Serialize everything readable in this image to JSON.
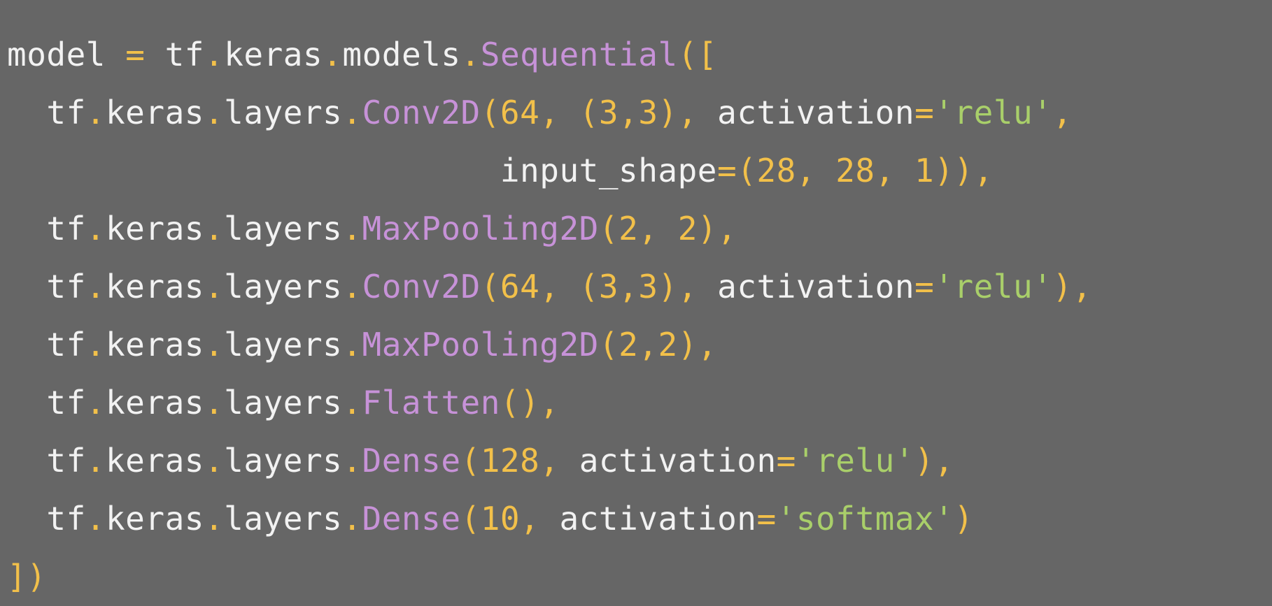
{
  "colors": {
    "background": "#666666",
    "identifier": "#f2f2f2",
    "punctuation": "#f2c04a",
    "function": "#c792d8",
    "number": "#f2c04a",
    "string": "#a9cf6a"
  },
  "code": {
    "lines": [
      [
        {
          "t": "model",
          "k": "id"
        },
        {
          "t": " ",
          "k": "id"
        },
        {
          "t": "=",
          "k": "punct"
        },
        {
          "t": " tf",
          "k": "id"
        },
        {
          "t": ".",
          "k": "punct"
        },
        {
          "t": "keras",
          "k": "id"
        },
        {
          "t": ".",
          "k": "punct"
        },
        {
          "t": "models",
          "k": "id"
        },
        {
          "t": ".",
          "k": "punct"
        },
        {
          "t": "Sequential",
          "k": "func"
        },
        {
          "t": "([",
          "k": "punct"
        }
      ],
      [
        {
          "t": "  tf",
          "k": "id"
        },
        {
          "t": ".",
          "k": "punct"
        },
        {
          "t": "keras",
          "k": "id"
        },
        {
          "t": ".",
          "k": "punct"
        },
        {
          "t": "layers",
          "k": "id"
        },
        {
          "t": ".",
          "k": "punct"
        },
        {
          "t": "Conv2D",
          "k": "func"
        },
        {
          "t": "(",
          "k": "punct"
        },
        {
          "t": "64",
          "k": "num"
        },
        {
          "t": ",",
          "k": "punct"
        },
        {
          "t": " ",
          "k": "id"
        },
        {
          "t": "(",
          "k": "punct"
        },
        {
          "t": "3",
          "k": "num"
        },
        {
          "t": ",",
          "k": "punct"
        },
        {
          "t": "3",
          "k": "num"
        },
        {
          "t": ")",
          "k": "punct"
        },
        {
          "t": ",",
          "k": "punct"
        },
        {
          "t": " activation",
          "k": "id"
        },
        {
          "t": "=",
          "k": "punct"
        },
        {
          "t": "'relu'",
          "k": "str"
        },
        {
          "t": ",",
          "k": "punct"
        }
      ],
      [
        {
          "t": "                         input_shape",
          "k": "id"
        },
        {
          "t": "=(",
          "k": "punct"
        },
        {
          "t": "28",
          "k": "num"
        },
        {
          "t": ",",
          "k": "punct"
        },
        {
          "t": " ",
          "k": "id"
        },
        {
          "t": "28",
          "k": "num"
        },
        {
          "t": ",",
          "k": "punct"
        },
        {
          "t": " ",
          "k": "id"
        },
        {
          "t": "1",
          "k": "num"
        },
        {
          "t": ")),",
          "k": "punct"
        }
      ],
      [
        {
          "t": "  tf",
          "k": "id"
        },
        {
          "t": ".",
          "k": "punct"
        },
        {
          "t": "keras",
          "k": "id"
        },
        {
          "t": ".",
          "k": "punct"
        },
        {
          "t": "layers",
          "k": "id"
        },
        {
          "t": ".",
          "k": "punct"
        },
        {
          "t": "MaxPooling2D",
          "k": "func"
        },
        {
          "t": "(",
          "k": "punct"
        },
        {
          "t": "2",
          "k": "num"
        },
        {
          "t": ",",
          "k": "punct"
        },
        {
          "t": " ",
          "k": "id"
        },
        {
          "t": "2",
          "k": "num"
        },
        {
          "t": "),",
          "k": "punct"
        }
      ],
      [
        {
          "t": "  tf",
          "k": "id"
        },
        {
          "t": ".",
          "k": "punct"
        },
        {
          "t": "keras",
          "k": "id"
        },
        {
          "t": ".",
          "k": "punct"
        },
        {
          "t": "layers",
          "k": "id"
        },
        {
          "t": ".",
          "k": "punct"
        },
        {
          "t": "Conv2D",
          "k": "func"
        },
        {
          "t": "(",
          "k": "punct"
        },
        {
          "t": "64",
          "k": "num"
        },
        {
          "t": ",",
          "k": "punct"
        },
        {
          "t": " ",
          "k": "id"
        },
        {
          "t": "(",
          "k": "punct"
        },
        {
          "t": "3",
          "k": "num"
        },
        {
          "t": ",",
          "k": "punct"
        },
        {
          "t": "3",
          "k": "num"
        },
        {
          "t": ")",
          "k": "punct"
        },
        {
          "t": ",",
          "k": "punct"
        },
        {
          "t": " activation",
          "k": "id"
        },
        {
          "t": "=",
          "k": "punct"
        },
        {
          "t": "'relu'",
          "k": "str"
        },
        {
          "t": "),",
          "k": "punct"
        }
      ],
      [
        {
          "t": "  tf",
          "k": "id"
        },
        {
          "t": ".",
          "k": "punct"
        },
        {
          "t": "keras",
          "k": "id"
        },
        {
          "t": ".",
          "k": "punct"
        },
        {
          "t": "layers",
          "k": "id"
        },
        {
          "t": ".",
          "k": "punct"
        },
        {
          "t": "MaxPooling2D",
          "k": "func"
        },
        {
          "t": "(",
          "k": "punct"
        },
        {
          "t": "2",
          "k": "num"
        },
        {
          "t": ",",
          "k": "punct"
        },
        {
          "t": "2",
          "k": "num"
        },
        {
          "t": "),",
          "k": "punct"
        }
      ],
      [
        {
          "t": "  tf",
          "k": "id"
        },
        {
          "t": ".",
          "k": "punct"
        },
        {
          "t": "keras",
          "k": "id"
        },
        {
          "t": ".",
          "k": "punct"
        },
        {
          "t": "layers",
          "k": "id"
        },
        {
          "t": ".",
          "k": "punct"
        },
        {
          "t": "Flatten",
          "k": "func"
        },
        {
          "t": "(),",
          "k": "punct"
        }
      ],
      [
        {
          "t": "  tf",
          "k": "id"
        },
        {
          "t": ".",
          "k": "punct"
        },
        {
          "t": "keras",
          "k": "id"
        },
        {
          "t": ".",
          "k": "punct"
        },
        {
          "t": "layers",
          "k": "id"
        },
        {
          "t": ".",
          "k": "punct"
        },
        {
          "t": "Dense",
          "k": "func"
        },
        {
          "t": "(",
          "k": "punct"
        },
        {
          "t": "128",
          "k": "num"
        },
        {
          "t": ",",
          "k": "punct"
        },
        {
          "t": " activation",
          "k": "id"
        },
        {
          "t": "=",
          "k": "punct"
        },
        {
          "t": "'relu'",
          "k": "str"
        },
        {
          "t": "),",
          "k": "punct"
        }
      ],
      [
        {
          "t": "  tf",
          "k": "id"
        },
        {
          "t": ".",
          "k": "punct"
        },
        {
          "t": "keras",
          "k": "id"
        },
        {
          "t": ".",
          "k": "punct"
        },
        {
          "t": "layers",
          "k": "id"
        },
        {
          "t": ".",
          "k": "punct"
        },
        {
          "t": "Dense",
          "k": "func"
        },
        {
          "t": "(",
          "k": "punct"
        },
        {
          "t": "10",
          "k": "num"
        },
        {
          "t": ",",
          "k": "punct"
        },
        {
          "t": " activation",
          "k": "id"
        },
        {
          "t": "=",
          "k": "punct"
        },
        {
          "t": "'softmax'",
          "k": "str"
        },
        {
          "t": ")",
          "k": "punct"
        }
      ],
      [
        {
          "t": "])",
          "k": "punct"
        }
      ]
    ]
  }
}
